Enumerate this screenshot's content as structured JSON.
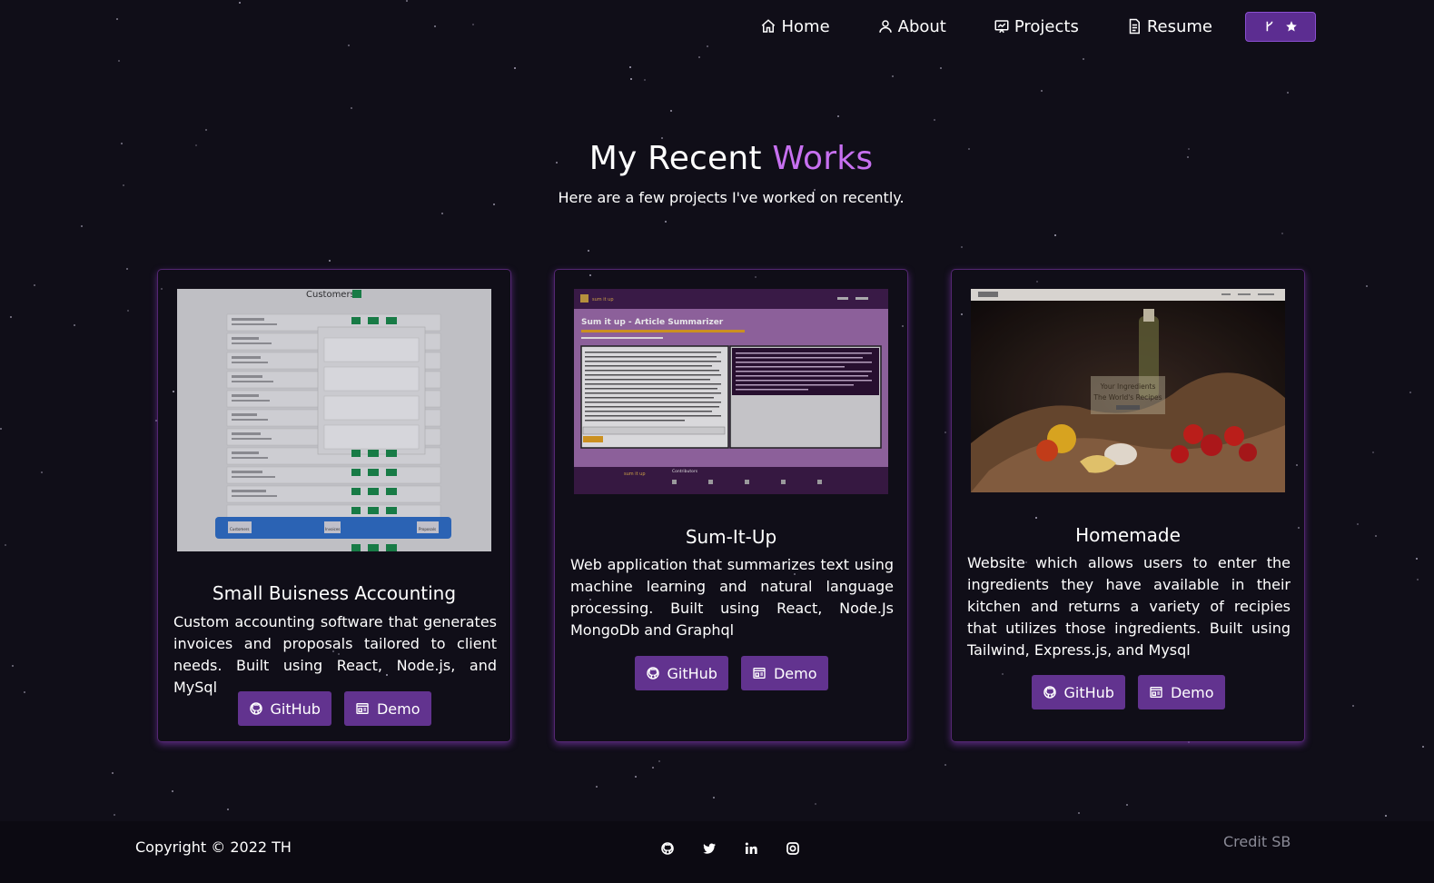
{
  "nav": {
    "items": [
      {
        "label": "Home",
        "icon": "home-icon"
      },
      {
        "label": "About",
        "icon": "user-icon"
      },
      {
        "label": "Projects",
        "icon": "projects-icon"
      },
      {
        "label": "Resume",
        "icon": "document-icon"
      }
    ],
    "fork_icon": "git-fork-icon",
    "star_icon": "star-icon"
  },
  "header": {
    "title_main": "My Recent ",
    "title_accent": "Works",
    "subtitle": "Here are a few projects I've worked on recently."
  },
  "projects": [
    {
      "title": "Small Buisness Accounting",
      "description": "Custom accounting software that generates invoices and proposals tailored to client needs. Built using React, Node.js, and MySql",
      "github_label": "GitHub",
      "demo_label": "Demo",
      "screenshot": {
        "heading": "Customers",
        "nav_labels": [
          "Customers",
          "Invoices",
          "Proposals"
        ]
      }
    },
    {
      "title": "Sum-It-Up",
      "description": "Web application that summarizes text using machine learning and natural language processing. Built using React, Node.Js MongoDb and Graphql",
      "github_label": "GitHub",
      "demo_label": "Demo",
      "screenshot": {
        "brand": "sum it up",
        "heading": "Sum it up - Article Summarizer",
        "footer_heading": "Contributors"
      }
    },
    {
      "title": "Homemade",
      "description": "Website which allows users to enter the ingredients they have available in their kitchen and returns a variety of recipies that utilizes those ingredients. Built using Tailwind, Express.js, and Mysql",
      "github_label": "GitHub",
      "demo_label": "Demo",
      "screenshot": {
        "tagline_1": "Your Ingredients",
        "tagline_2": "The World's Recipes"
      }
    }
  ],
  "footer": {
    "copyright": "Copyright © 2022 TH",
    "credit": "Credit SB",
    "socials": [
      "github-icon",
      "twitter-icon",
      "linkedin-icon",
      "instagram-icon"
    ]
  },
  "colors": {
    "background": "#100e18",
    "accent": "#c770f0",
    "button": "#62338f",
    "footer": "#0c0a12"
  }
}
